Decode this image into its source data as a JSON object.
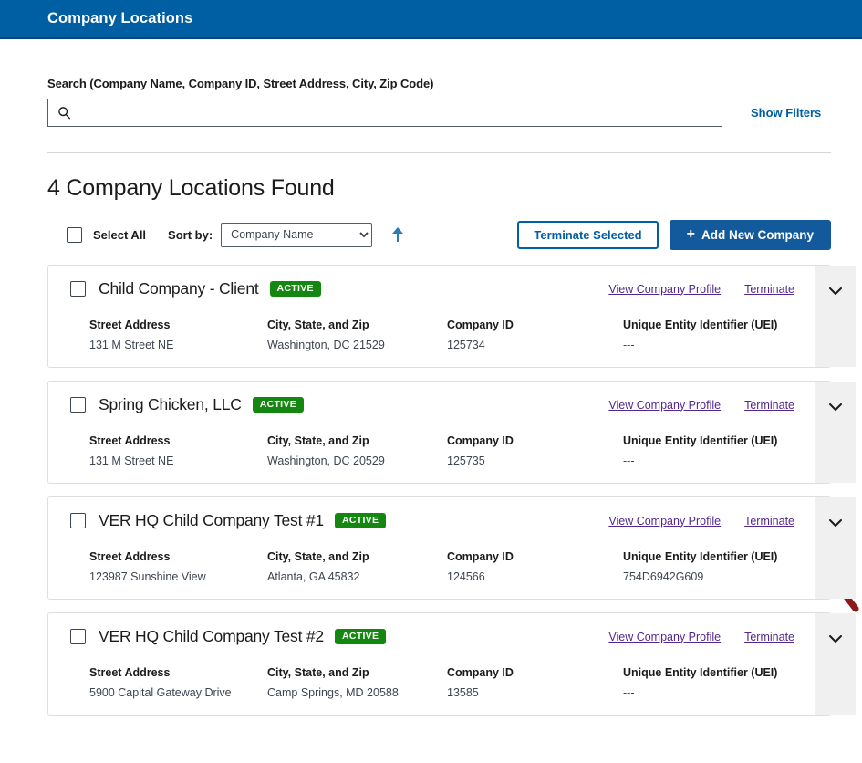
{
  "header": {
    "title": "Company Locations"
  },
  "search": {
    "label": "Search (Company Name, Company ID, Street Address, City, Zip Code)",
    "value": "",
    "placeholder": "",
    "icon": "search-icon",
    "show_filters_label": "Show Filters"
  },
  "results": {
    "heading": "4 Company Locations Found",
    "count": 4
  },
  "toolbar": {
    "select_all_label": "Select All",
    "sort_by_label": "Sort by:",
    "sort_selected": "Company Name",
    "sort_options": [
      "Company Name"
    ],
    "sort_direction_icon": "arrow-up-icon",
    "terminate_selected_label": "Terminate Selected",
    "add_new_company_label": "Add New Company",
    "add_new_company_plus": "+"
  },
  "card_labels": {
    "street_address": "Street Address",
    "city_state_zip": "City, State, and Zip",
    "company_id": "Company ID",
    "uei": "Unique Entity Identifier (UEI)",
    "view_profile": "View Company Profile",
    "terminate": "Terminate",
    "expand_icon": "chevron-down-icon"
  },
  "companies": [
    {
      "name": "Child Company - Client",
      "status": "ACTIVE",
      "street_address": "131 M Street NE",
      "city_state_zip": "Washington, DC 21529",
      "company_id": "125734",
      "uei": "---"
    },
    {
      "name": "Spring Chicken, LLC",
      "status": "ACTIVE",
      "street_address": "131 M Street NE",
      "city_state_zip": "Washington, DC 20529",
      "company_id": "125735",
      "uei": "---"
    },
    {
      "name": "VER HQ Child Company Test #1",
      "status": "ACTIVE",
      "street_address": "123987 Sunshine View",
      "city_state_zip": "Atlanta, GA 45832",
      "company_id": "124566",
      "uei": "754D6942G609"
    },
    {
      "name": "VER HQ Child Company Test #2",
      "status": "ACTIVE",
      "street_address": "5900 Capital Gateway Drive",
      "city_state_zip": "Camp Springs, MD 20588",
      "company_id": "13585",
      "uei": "---"
    }
  ],
  "annotation": {
    "type": "arrow",
    "points_to": "Terminate",
    "color": "#8b1a1a"
  },
  "colors": {
    "header_bg": "#005ea2",
    "primary": "#125a9c",
    "link": "#005ea2",
    "card_link": "#54278f",
    "badge_active": "#13870f",
    "annotation": "#8b1a1a"
  }
}
